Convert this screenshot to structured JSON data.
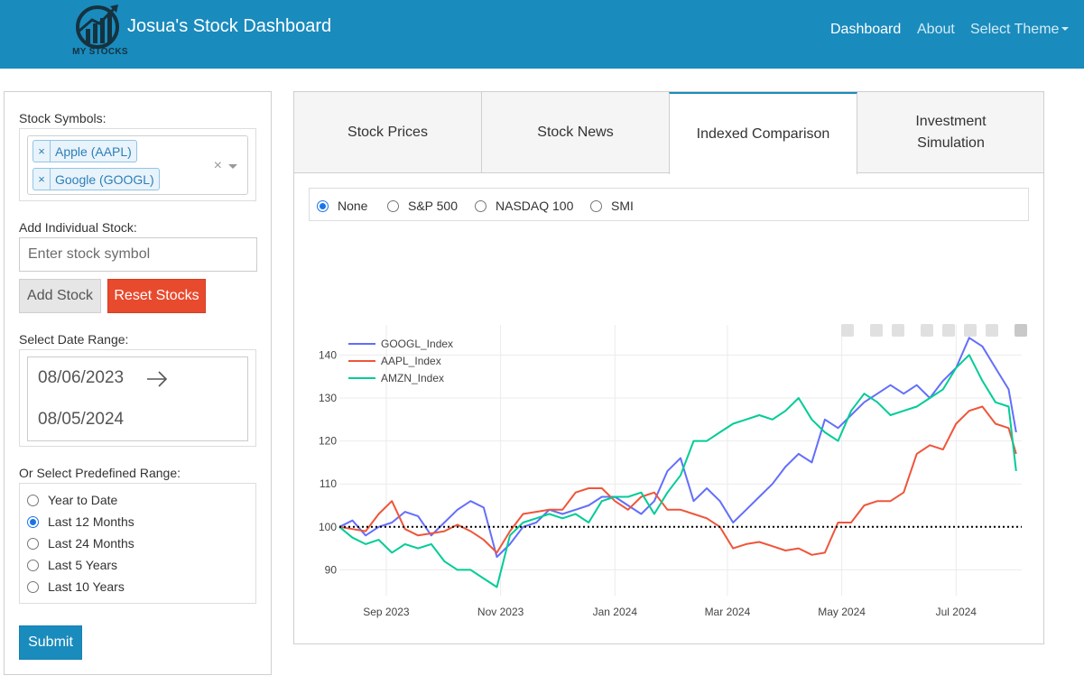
{
  "navbar": {
    "logo_text": "MY STOCKS",
    "brand": "Josua's Stock Dashboard",
    "items": [
      {
        "label": "Dashboard",
        "active": true
      },
      {
        "label": "About",
        "active": false
      },
      {
        "label": "Select Theme",
        "active": false
      }
    ],
    "bg_color": "#1a8bbd"
  },
  "sidebar": {
    "symbols_label": "Stock Symbols:",
    "selected_symbols": [
      "Apple (AAPL)",
      "Google (GOOGL)"
    ],
    "chip_remove_glyph": "×",
    "clear_glyph": "×",
    "add_label": "Add Individual Stock:",
    "add_placeholder": "Enter stock symbol",
    "add_button": "Add Stock",
    "reset_button": "Reset Stocks",
    "date_label": "Select Date Range:",
    "start_date": "08/06/2023",
    "end_date": "08/05/2024",
    "range_label": "Or Select Predefined Range:",
    "ranges": [
      "Year to Date",
      "Last 12 Months",
      "Last 24 Months",
      "Last 5 Years",
      "Last 10 Years"
    ],
    "selected_range": "Last 12 Months",
    "submit_button": "Submit"
  },
  "tabs": [
    {
      "label": "Stock Prices",
      "active": false
    },
    {
      "label": "Stock News",
      "active": false
    },
    {
      "label": "Indexed Comparison",
      "active": true
    },
    {
      "label": "Investment Simulation",
      "active": false
    }
  ],
  "benchmarks": {
    "options": [
      "None",
      "S&P 500",
      "NASDAQ 100",
      "SMI"
    ],
    "selected": "None"
  },
  "modebar_icons": [
    "camera-icon",
    "zoom-icon",
    "pan-icon",
    "zoom-in-icon",
    "zoom-out-icon",
    "autoscale-icon",
    "home-icon",
    "plotly-logo-icon"
  ],
  "chart_data": {
    "type": "line",
    "title": "",
    "xlabel": "",
    "ylabel": "",
    "ylim": [
      84,
      147
    ],
    "xlim": [
      "2023-08-07",
      "2024-08-05"
    ],
    "x_ticks": [
      {
        "date": "2023-09-01",
        "label": "Sep 2023"
      },
      {
        "date": "2023-11-01",
        "label": "Nov 2023"
      },
      {
        "date": "2024-01-01",
        "label": "Jan 2024"
      },
      {
        "date": "2024-03-01",
        "label": "Mar 2024"
      },
      {
        "date": "2024-05-01",
        "label": "May 2024"
      },
      {
        "date": "2024-07-01",
        "label": "Jul 2024"
      }
    ],
    "y_ticks": [
      90,
      100,
      110,
      120,
      130,
      140
    ],
    "baseline": 100,
    "legend_position": "top-left",
    "series": [
      {
        "name": "GOOGL_Index",
        "color": "#636efa",
        "points": [
          [
            "2023-08-07",
            100
          ],
          [
            "2023-08-14",
            101.5
          ],
          [
            "2023-08-21",
            98
          ],
          [
            "2023-08-28",
            100
          ],
          [
            "2023-09-04",
            101
          ],
          [
            "2023-09-11",
            103.5
          ],
          [
            "2023-09-18",
            102.5
          ],
          [
            "2023-09-25",
            98
          ],
          [
            "2023-10-02",
            101
          ],
          [
            "2023-10-09",
            104
          ],
          [
            "2023-10-16",
            106
          ],
          [
            "2023-10-23",
            104.5
          ],
          [
            "2023-10-30",
            93
          ],
          [
            "2023-11-06",
            96
          ],
          [
            "2023-11-13",
            100
          ],
          [
            "2023-11-20",
            101
          ],
          [
            "2023-11-27",
            104
          ],
          [
            "2023-12-04",
            103
          ],
          [
            "2023-12-11",
            104
          ],
          [
            "2023-12-18",
            105
          ],
          [
            "2023-12-25",
            107
          ],
          [
            "2024-01-01",
            107
          ],
          [
            "2024-01-08",
            105
          ],
          [
            "2024-01-15",
            103
          ],
          [
            "2024-01-22",
            106
          ],
          [
            "2024-01-29",
            113
          ],
          [
            "2024-02-05",
            116
          ],
          [
            "2024-02-12",
            106
          ],
          [
            "2024-02-19",
            109
          ],
          [
            "2024-02-26",
            106
          ],
          [
            "2024-03-04",
            101
          ],
          [
            "2024-03-11",
            104
          ],
          [
            "2024-03-18",
            107
          ],
          [
            "2024-03-25",
            110
          ],
          [
            "2024-04-01",
            114
          ],
          [
            "2024-04-08",
            117
          ],
          [
            "2024-04-15",
            115
          ],
          [
            "2024-04-22",
            125
          ],
          [
            "2024-04-29",
            123
          ],
          [
            "2024-05-06",
            126
          ],
          [
            "2024-05-13",
            129
          ],
          [
            "2024-05-20",
            131
          ],
          [
            "2024-05-27",
            133
          ],
          [
            "2024-06-03",
            131
          ],
          [
            "2024-06-10",
            133
          ],
          [
            "2024-06-17",
            130
          ],
          [
            "2024-06-24",
            134
          ],
          [
            "2024-07-01",
            137
          ],
          [
            "2024-07-08",
            144
          ],
          [
            "2024-07-15",
            142
          ],
          [
            "2024-07-22",
            137
          ],
          [
            "2024-07-29",
            132
          ],
          [
            "2024-08-02",
            122
          ]
        ]
      },
      {
        "name": "AAPL_Index",
        "color": "#ef553b",
        "points": [
          [
            "2023-08-07",
            100
          ],
          [
            "2023-08-14",
            99.5
          ],
          [
            "2023-08-21",
            99
          ],
          [
            "2023-08-28",
            103
          ],
          [
            "2023-09-04",
            106
          ],
          [
            "2023-09-11",
            99.5
          ],
          [
            "2023-09-18",
            98
          ],
          [
            "2023-09-25",
            98.5
          ],
          [
            "2023-10-02",
            99
          ],
          [
            "2023-10-09",
            100.5
          ],
          [
            "2023-10-16",
            99
          ],
          [
            "2023-10-23",
            97
          ],
          [
            "2023-10-30",
            94
          ],
          [
            "2023-11-06",
            99
          ],
          [
            "2023-11-13",
            103
          ],
          [
            "2023-11-20",
            103.5
          ],
          [
            "2023-11-27",
            104
          ],
          [
            "2023-12-04",
            104
          ],
          [
            "2023-12-11",
            108
          ],
          [
            "2023-12-18",
            109
          ],
          [
            "2023-12-25",
            109
          ],
          [
            "2024-01-01",
            106
          ],
          [
            "2024-01-08",
            104
          ],
          [
            "2024-01-15",
            107
          ],
          [
            "2024-01-22",
            108
          ],
          [
            "2024-01-29",
            104
          ],
          [
            "2024-02-05",
            104
          ],
          [
            "2024-02-12",
            103
          ],
          [
            "2024-02-19",
            102
          ],
          [
            "2024-02-26",
            100
          ],
          [
            "2024-03-04",
            95
          ],
          [
            "2024-03-11",
            96
          ],
          [
            "2024-03-18",
            96.5
          ],
          [
            "2024-03-25",
            95.5
          ],
          [
            "2024-04-01",
            94.5
          ],
          [
            "2024-04-08",
            95
          ],
          [
            "2024-04-15",
            93.5
          ],
          [
            "2024-04-22",
            94
          ],
          [
            "2024-04-29",
            101
          ],
          [
            "2024-05-06",
            101
          ],
          [
            "2024-05-13",
            105
          ],
          [
            "2024-05-20",
            106
          ],
          [
            "2024-05-27",
            106
          ],
          [
            "2024-06-03",
            108
          ],
          [
            "2024-06-10",
            117
          ],
          [
            "2024-06-17",
            119
          ],
          [
            "2024-06-24",
            118
          ],
          [
            "2024-07-01",
            124
          ],
          [
            "2024-07-08",
            127
          ],
          [
            "2024-07-15",
            128
          ],
          [
            "2024-07-22",
            124
          ],
          [
            "2024-07-29",
            123
          ],
          [
            "2024-08-02",
            117
          ]
        ]
      },
      {
        "name": "AMZN_Index",
        "color": "#00cc96",
        "points": [
          [
            "2023-08-07",
            100
          ],
          [
            "2023-08-14",
            97.5
          ],
          [
            "2023-08-21",
            96
          ],
          [
            "2023-08-28",
            97
          ],
          [
            "2023-09-04",
            94
          ],
          [
            "2023-09-11",
            96
          ],
          [
            "2023-09-18",
            95
          ],
          [
            "2023-09-25",
            96
          ],
          [
            "2023-10-02",
            92
          ],
          [
            "2023-10-09",
            90
          ],
          [
            "2023-10-16",
            90
          ],
          [
            "2023-10-23",
            88
          ],
          [
            "2023-10-30",
            86
          ],
          [
            "2023-11-06",
            98
          ],
          [
            "2023-11-13",
            101
          ],
          [
            "2023-11-20",
            102
          ],
          [
            "2023-11-27",
            103
          ],
          [
            "2023-12-04",
            102
          ],
          [
            "2023-12-11",
            103
          ],
          [
            "2023-12-18",
            101
          ],
          [
            "2023-12-25",
            106
          ],
          [
            "2024-01-01",
            107
          ],
          [
            "2024-01-08",
            107
          ],
          [
            "2024-01-15",
            108
          ],
          [
            "2024-01-22",
            103
          ],
          [
            "2024-01-29",
            108
          ],
          [
            "2024-02-05",
            112
          ],
          [
            "2024-02-12",
            120
          ],
          [
            "2024-02-19",
            120
          ],
          [
            "2024-02-26",
            122
          ],
          [
            "2024-03-04",
            124
          ],
          [
            "2024-03-11",
            125
          ],
          [
            "2024-03-18",
            126
          ],
          [
            "2024-03-25",
            125
          ],
          [
            "2024-04-01",
            127
          ],
          [
            "2024-04-08",
            130
          ],
          [
            "2024-04-15",
            125
          ],
          [
            "2024-04-22",
            122
          ],
          [
            "2024-04-29",
            120
          ],
          [
            "2024-05-06",
            127
          ],
          [
            "2024-05-13",
            131
          ],
          [
            "2024-05-20",
            129
          ],
          [
            "2024-05-27",
            126
          ],
          [
            "2024-06-03",
            127
          ],
          [
            "2024-06-10",
            128
          ],
          [
            "2024-06-17",
            130
          ],
          [
            "2024-06-24",
            132
          ],
          [
            "2024-07-01",
            137
          ],
          [
            "2024-07-08",
            140
          ],
          [
            "2024-07-15",
            134
          ],
          [
            "2024-07-22",
            129
          ],
          [
            "2024-07-29",
            128
          ],
          [
            "2024-08-02",
            113
          ]
        ]
      }
    ]
  }
}
